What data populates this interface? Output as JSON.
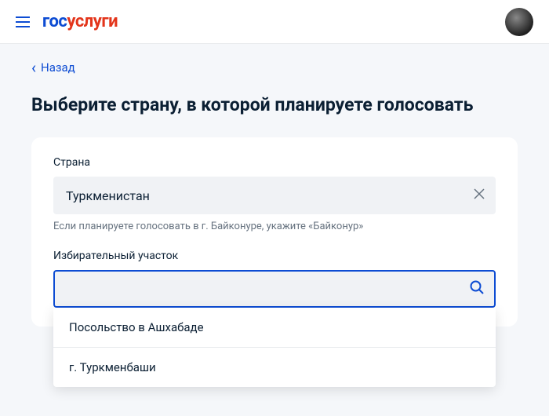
{
  "header": {
    "logo_part1": "гос",
    "logo_part2": "услуги"
  },
  "nav": {
    "back_label": "Назад"
  },
  "page": {
    "title": "Выберите страну, в которой планируете голосовать"
  },
  "form": {
    "country_label": "Страна",
    "country_value": "Туркменистан",
    "country_hint": "Если планируете голосовать в г. Байконуре, укажите «Байконур»",
    "station_label": "Избирательный участок",
    "station_value": "",
    "options": [
      "Посольство в Ашхабаде",
      "г. Туркменбаши"
    ]
  }
}
